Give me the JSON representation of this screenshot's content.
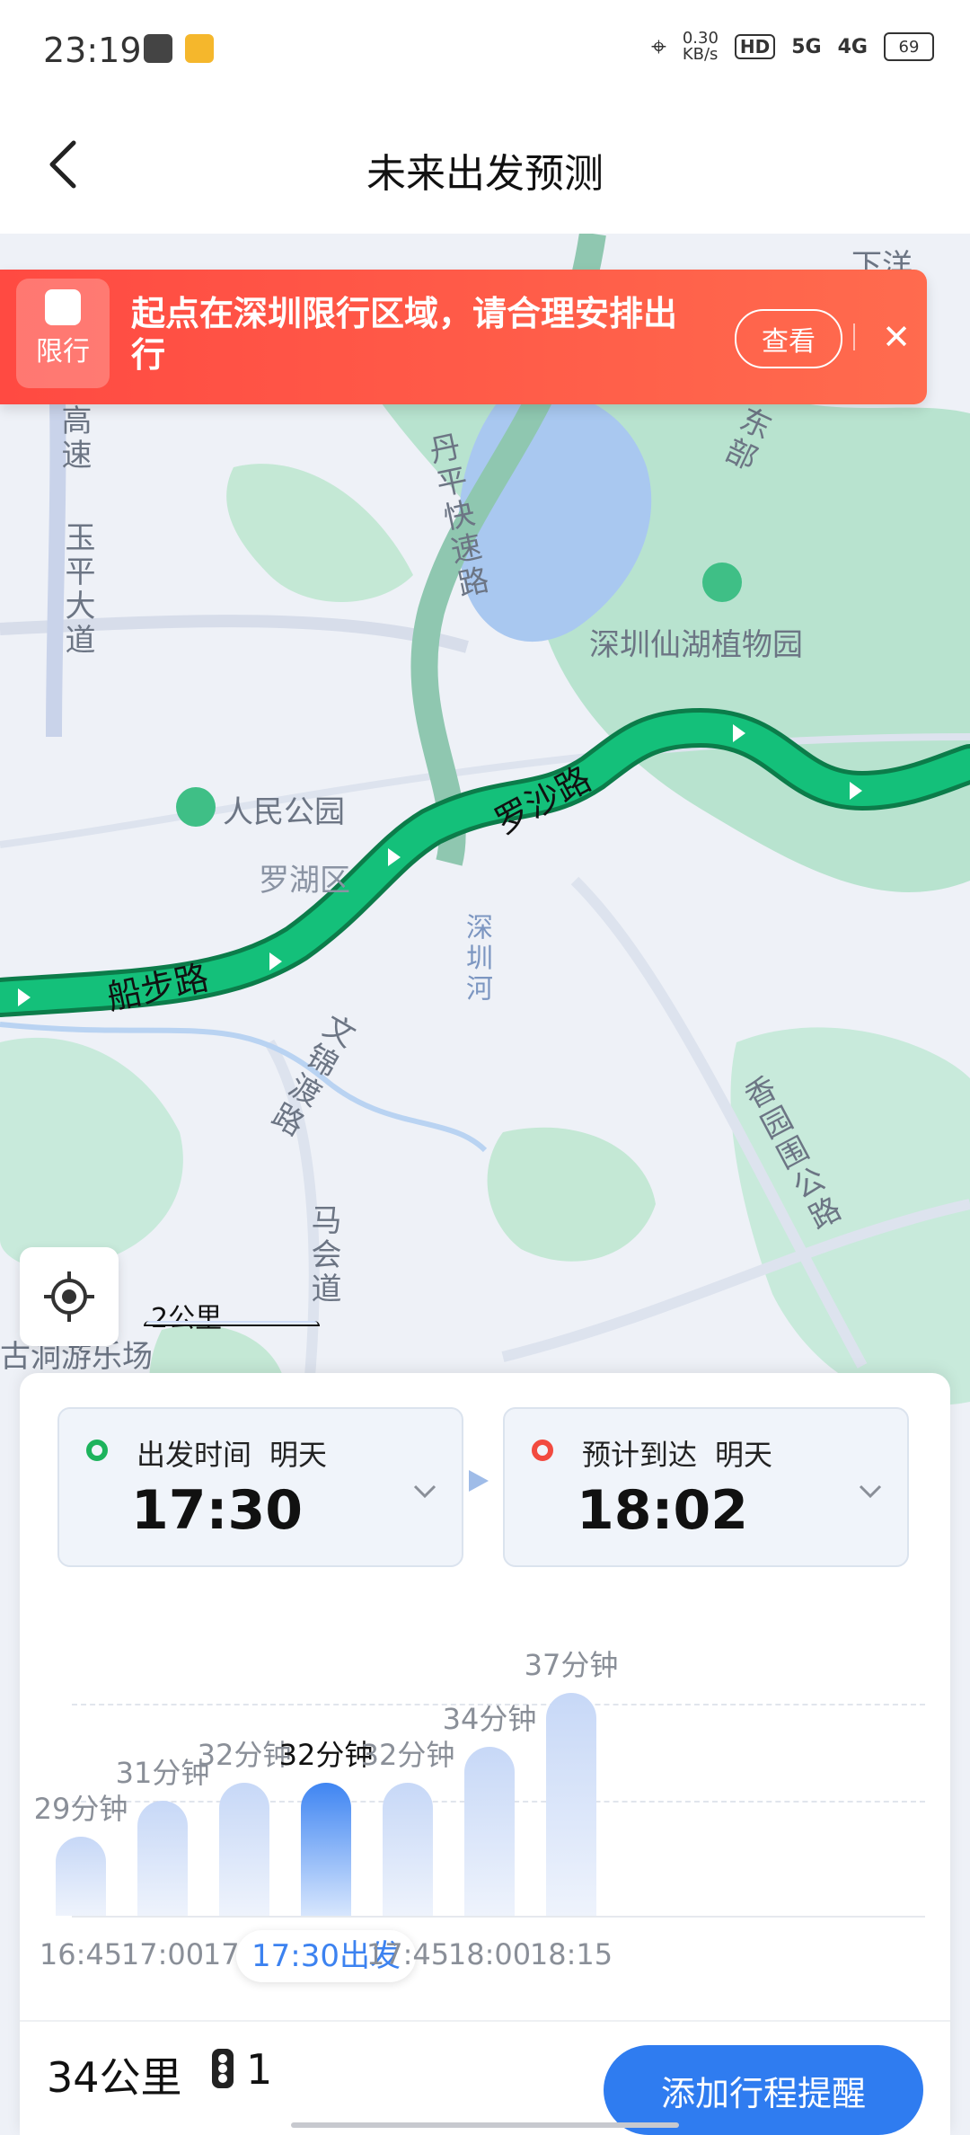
{
  "status_bar": {
    "time": "23:19",
    "net_speed": "0.30\nKB/s",
    "hd": "HD",
    "sig1": "5G",
    "sig2": "4G",
    "battery": "69"
  },
  "header": {
    "title": "未来出发预测",
    "back_icon": "chevron-left-icon"
  },
  "banner": {
    "badge": "限行",
    "text": "起点在深圳限行区域，请合理安排出行",
    "view_button": "查看",
    "close_icon": "close-icon"
  },
  "map": {
    "labels": {
      "gaosu": "高速",
      "yuping": "玉平大道",
      "danping": "丹平快速路",
      "botanic": "深圳仙湖植物园",
      "park": "人民公园",
      "luohu": "罗湖区",
      "luosha": "罗沙路",
      "chuanbu": "船步路",
      "wenjindu": "文锦渡路",
      "shenzhenhe": "深圳河",
      "xianggang": "香园围公路",
      "mahui": "马会道",
      "guzhuang": "古洞游乐场",
      "xiayang": "下洋",
      "dongbu": "东部"
    },
    "scale": "2公里"
  },
  "departure": {
    "label": "出发时间",
    "day": "明天",
    "time": "17:30"
  },
  "arrival": {
    "label": "预计到达",
    "day": "明天",
    "time": "18:02"
  },
  "chart_data": {
    "type": "bar",
    "categories": [
      "16:45",
      "17:00",
      "17:15",
      "17:30出发",
      "17:45",
      "18:00",
      "18:15"
    ],
    "values": [
      29,
      31,
      32,
      32,
      32,
      34,
      37
    ],
    "value_labels": [
      "29分钟",
      "31分钟",
      "32分钟",
      "32分钟",
      "32分钟",
      "34分钟",
      "37分钟"
    ],
    "selected_index": 3,
    "unit": "分钟"
  },
  "summary": {
    "distance": "34公里",
    "traffic_lights": "1",
    "remind_button": "添加行程提醒"
  },
  "colors": {
    "accent": "#2f7cf0",
    "route": "#11b56a",
    "banner": "#ff4a42"
  }
}
